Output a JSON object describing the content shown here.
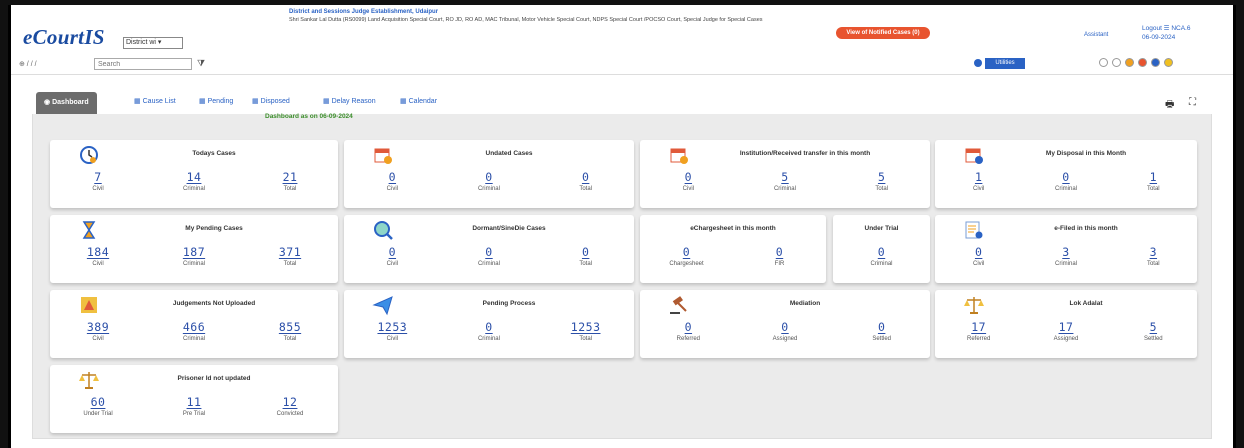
{
  "app": {
    "logo": "eCourtIS",
    "establishment_select": "District wi"
  },
  "establishment": {
    "title": "District and Sessions Judge Establishment, Udaipur",
    "line": "Shri Sankar Lal Dutta (RS0099) Land Acquisition Special Court, RO JD, RO AD, MAC Tribunal, Motor Vehicle Special Court, NDPS Special Court /POCSO Court, Special Judge for Special Cases"
  },
  "header": {
    "notified_button": "View of Notified Cases (0)",
    "user": "Assistant",
    "logout": "Logout ☰ NCA.6",
    "date": "06-09-2024"
  },
  "toolbar": {
    "breadcrumb": "⊕ / / /",
    "search_placeholder": "Search",
    "utilities_label": "Utilities"
  },
  "tabs": [
    {
      "label": "Dashboard",
      "icon": "dashboard-icon"
    },
    {
      "label": "Cause List",
      "icon": "list-icon"
    },
    {
      "label": "Pending",
      "icon": "pending-icon"
    },
    {
      "label": "Disposed",
      "icon": "disposed-icon"
    },
    {
      "label": "Delay Reason",
      "icon": "calendar-icon"
    },
    {
      "label": "Calendar",
      "icon": "calendar-icon"
    }
  ],
  "dashboard_as_on": "Dashboard as on 06-09-2024",
  "cards": [
    {
      "title": "Todays Cases",
      "icon": "clock-icon",
      "stats": [
        {
          "v": "7",
          "l": "Civil"
        },
        {
          "v": "14",
          "l": "Criminal"
        },
        {
          "v": "21",
          "l": "Total"
        }
      ]
    },
    {
      "title": "Undated Cases",
      "icon": "calendar-warning-icon",
      "stats": [
        {
          "v": "0",
          "l": "Civil"
        },
        {
          "v": "0",
          "l": "Criminal"
        },
        {
          "v": "0",
          "l": "Total"
        }
      ]
    },
    {
      "title": "Institution/Received transfer in this month",
      "icon": "calendar-add-icon",
      "stats": [
        {
          "v": "0",
          "l": "Civil"
        },
        {
          "v": "5",
          "l": "Criminal"
        },
        {
          "v": "5",
          "l": "Total"
        }
      ]
    },
    {
      "title": "My Disposal in this Month",
      "icon": "calendar-check-icon",
      "stats": [
        {
          "v": "1",
          "l": "Civil"
        },
        {
          "v": "0",
          "l": "Criminal"
        },
        {
          "v": "1",
          "l": "Total"
        }
      ]
    },
    {
      "title": "My Pending Cases",
      "icon": "hourglass-icon",
      "stats": [
        {
          "v": "184",
          "l": "Civil"
        },
        {
          "v": "187",
          "l": "Criminal"
        },
        {
          "v": "371",
          "l": "Total"
        }
      ]
    },
    {
      "title": "Dormant/SineDie Cases",
      "icon": "magnifier-icon",
      "stats": [
        {
          "v": "0",
          "l": "Civil"
        },
        {
          "v": "0",
          "l": "Criminal"
        },
        {
          "v": "0",
          "l": "Total"
        }
      ]
    },
    {
      "title": "eChargesheet in this month",
      "icon": "",
      "stats": [
        {
          "v": "0",
          "l": "Chargesheet"
        },
        {
          "v": "0",
          "l": "FIR"
        }
      ]
    },
    {
      "title": "Under Trial",
      "icon": "",
      "stats": [
        {
          "v": "0",
          "l": "Criminal"
        }
      ]
    },
    {
      "title": "e-Filed in this month",
      "icon": "efile-icon",
      "stats": [
        {
          "v": "0",
          "l": "Civil"
        },
        {
          "v": "3",
          "l": "Criminal"
        },
        {
          "v": "3",
          "l": "Total"
        }
      ]
    },
    {
      "title": "Judgements Not Uploaded",
      "icon": "upload-warning-icon",
      "stats": [
        {
          "v": "389",
          "l": "Civil"
        },
        {
          "v": "466",
          "l": "Criminal"
        },
        {
          "v": "855",
          "l": "Total"
        }
      ]
    },
    {
      "title": "Pending Process",
      "icon": "paper-plane-icon",
      "stats": [
        {
          "v": "1253",
          "l": "Civil"
        },
        {
          "v": "0",
          "l": "Criminal"
        },
        {
          "v": "1253",
          "l": "Total"
        }
      ]
    },
    {
      "title": "Mediation",
      "icon": "gavel-icon",
      "stats": [
        {
          "v": "0",
          "l": "Referred"
        },
        {
          "v": "0",
          "l": "Assigned"
        },
        {
          "v": "0",
          "l": "Settled"
        }
      ]
    },
    {
      "title": "Lok Adalat",
      "icon": "scales-icon",
      "stats": [
        {
          "v": "17",
          "l": "Referred"
        },
        {
          "v": "17",
          "l": "Assigned"
        },
        {
          "v": "5",
          "l": "Settled"
        }
      ]
    },
    {
      "title": "Prisoner Id not updated",
      "icon": "scales-icon",
      "stats": [
        {
          "v": "60",
          "l": "Under Trial"
        },
        {
          "v": "11",
          "l": "Pre Trial"
        },
        {
          "v": "12",
          "l": "Convicted"
        }
      ]
    }
  ],
  "colors": {
    "value_blue": "#2b4fa8",
    "link_blue": "#2a62c4",
    "tab_active": "#6c6c6c",
    "dashboard_date": "#3b8e2a",
    "notify": "#e8542f"
  },
  "status_dots": [
    "#ffffff",
    "#ffffff",
    "#f0a020",
    "#e8542f",
    "#2a62c4",
    "#f0c020"
  ]
}
